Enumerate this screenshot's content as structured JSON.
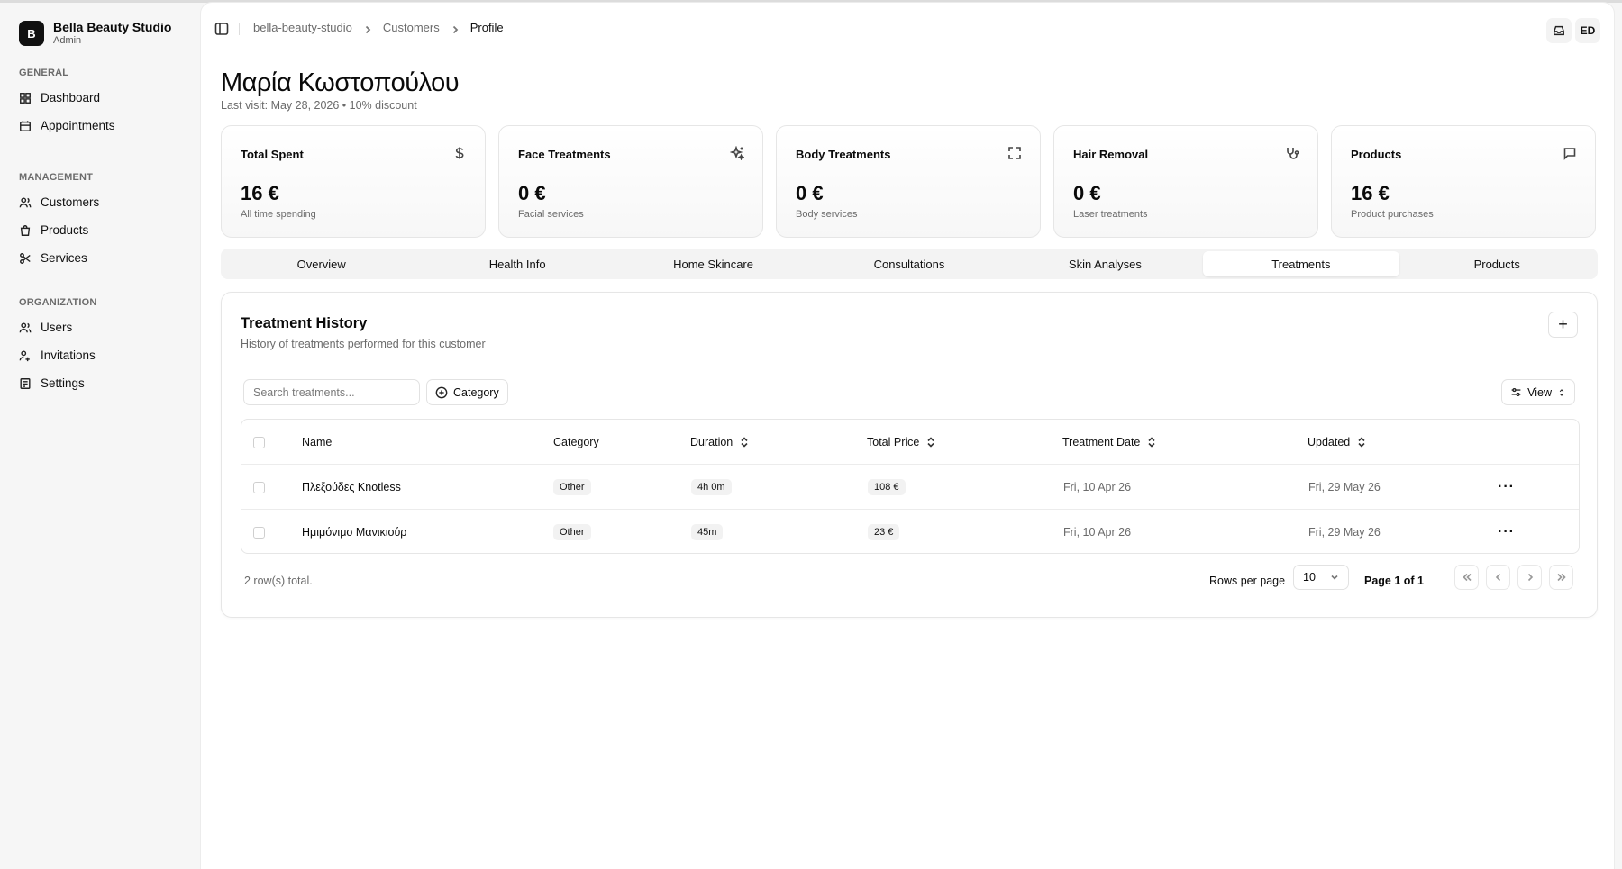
{
  "app": {
    "name": "Bella Beauty Studio",
    "role": "Admin",
    "logo_letter": "B"
  },
  "sidebar": {
    "sections": [
      {
        "title": "GENERAL",
        "items": [
          {
            "label": "Dashboard",
            "icon": "dashboard-icon"
          },
          {
            "label": "Appointments",
            "icon": "calendar-icon"
          }
        ]
      },
      {
        "title": "MANAGEMENT",
        "items": [
          {
            "label": "Customers",
            "icon": "users-icon"
          },
          {
            "label": "Products",
            "icon": "shopping-bag-icon"
          },
          {
            "label": "Services",
            "icon": "scissors-icon"
          }
        ]
      },
      {
        "title": "ORGANIZATION",
        "items": [
          {
            "label": "Users",
            "icon": "users-icon"
          },
          {
            "label": "Invitations",
            "icon": "user-plus-icon"
          },
          {
            "label": "Settings",
            "icon": "settings-icon"
          }
        ]
      }
    ]
  },
  "breadcrumb": [
    "bella-beauty-studio",
    "Customers",
    "Profile"
  ],
  "topbar": {
    "avatar_initials": "ED"
  },
  "customer": {
    "name": "Μαρία Κωστοπούλου",
    "subtitle": "Last visit: May 28, 2026 • 10% discount"
  },
  "stats": [
    {
      "title": "Total Spent",
      "value": "16 €",
      "desc": "All time spending",
      "icon": "dollar-icon"
    },
    {
      "title": "Face Treatments",
      "value": "0 €",
      "desc": "Facial services",
      "icon": "sparkles-icon"
    },
    {
      "title": "Body Treatments",
      "value": "0 €",
      "desc": "Body services",
      "icon": "expand-icon"
    },
    {
      "title": "Hair Removal",
      "value": "0 €",
      "desc": "Laser treatments",
      "icon": "stethoscope-icon"
    },
    {
      "title": "Products",
      "value": "16 €",
      "desc": "Product purchases",
      "icon": "message-square-icon"
    }
  ],
  "tabs": [
    "Overview",
    "Health Info",
    "Home Skincare",
    "Consultations",
    "Skin Analyses",
    "Treatments",
    "Products"
  ],
  "active_tab": "Treatments",
  "treatments": {
    "title": "Treatment History",
    "subtitle": "History of treatments performed for this customer",
    "search_placeholder": "Search treatments...",
    "category_filter_label": "Category",
    "view_label": "View",
    "columns": [
      "Name",
      "Category",
      "Duration",
      "Total Price",
      "Treatment Date",
      "Updated"
    ],
    "rows": [
      {
        "name": "Πλεξούδες Knotless",
        "category": "Other",
        "duration": "4h 0m",
        "price": "108 €",
        "date": "Fri, 10 Apr 26",
        "updated": "Fri, 29 May 26"
      },
      {
        "name": "Ημιμόνιμο Μανικιούρ",
        "category": "Other",
        "duration": "45m",
        "price": "23 €",
        "date": "Fri, 10 Apr 26",
        "updated": "Fri, 29 May 26"
      }
    ],
    "total_text": "2 row(s) total.",
    "rows_per_page_label": "Rows per page",
    "rows_per_page": "10",
    "page_text": "Page 1 of 1"
  }
}
